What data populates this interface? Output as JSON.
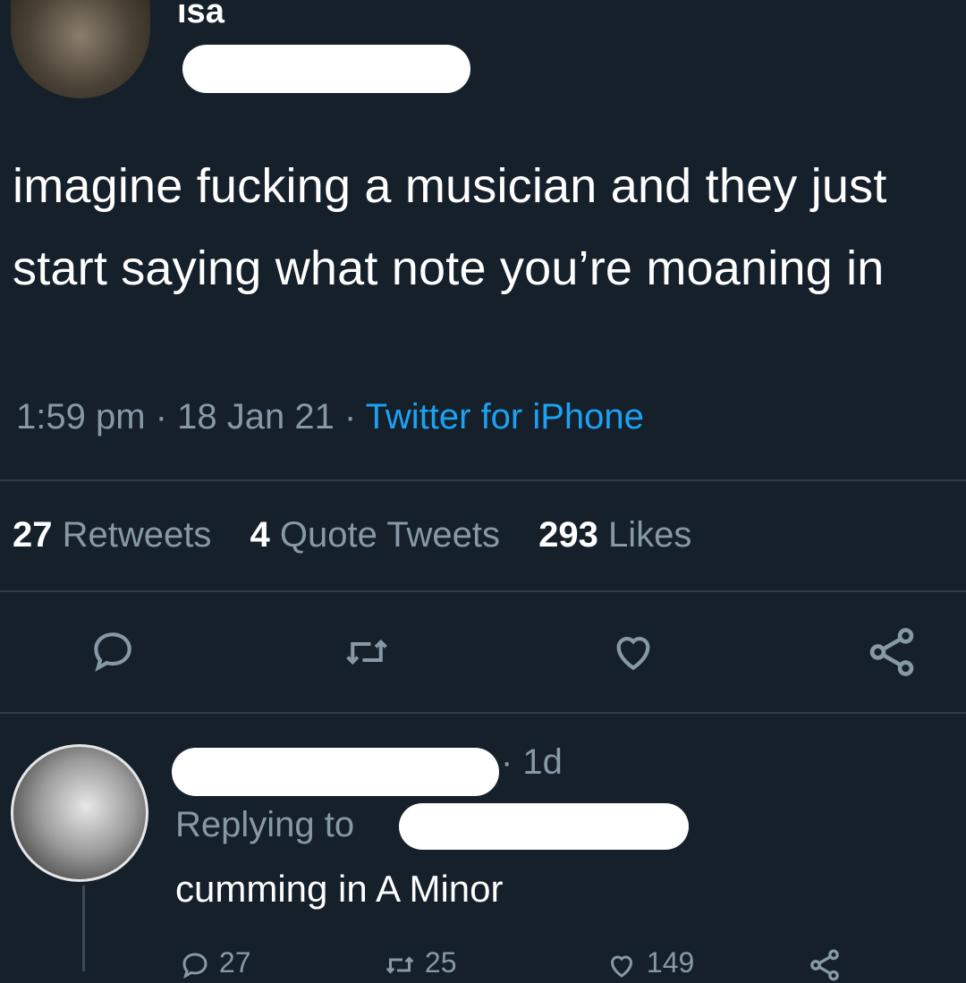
{
  "tweet": {
    "author_name_fragment": "ısa",
    "text": "imagine fucking a musician and they just start saying what note you’re moaning in",
    "time": "1:59 pm",
    "date": "18 Jan 21",
    "source": "Twitter for iPhone",
    "separator": "·"
  },
  "stats": {
    "retweets_count": "27",
    "retweets_label": "Retweets",
    "quotes_count": "4",
    "quotes_label": "Quote Tweets",
    "likes_count": "293",
    "likes_label": "Likes"
  },
  "actions": {
    "reply_icon": "comment-icon",
    "retweet_icon": "retweet-icon",
    "like_icon": "heart-icon",
    "share_icon": "share-icon"
  },
  "reply": {
    "time_ago": "· 1d",
    "replying_to_label": "Replying to",
    "text": "cumming in A Minor",
    "reply_count": "27",
    "retweet_count": "25",
    "like_count": "149"
  },
  "colors": {
    "background": "#15202b",
    "text": "#ffffff",
    "secondary": "#8899a6",
    "link": "#1da1f2"
  }
}
